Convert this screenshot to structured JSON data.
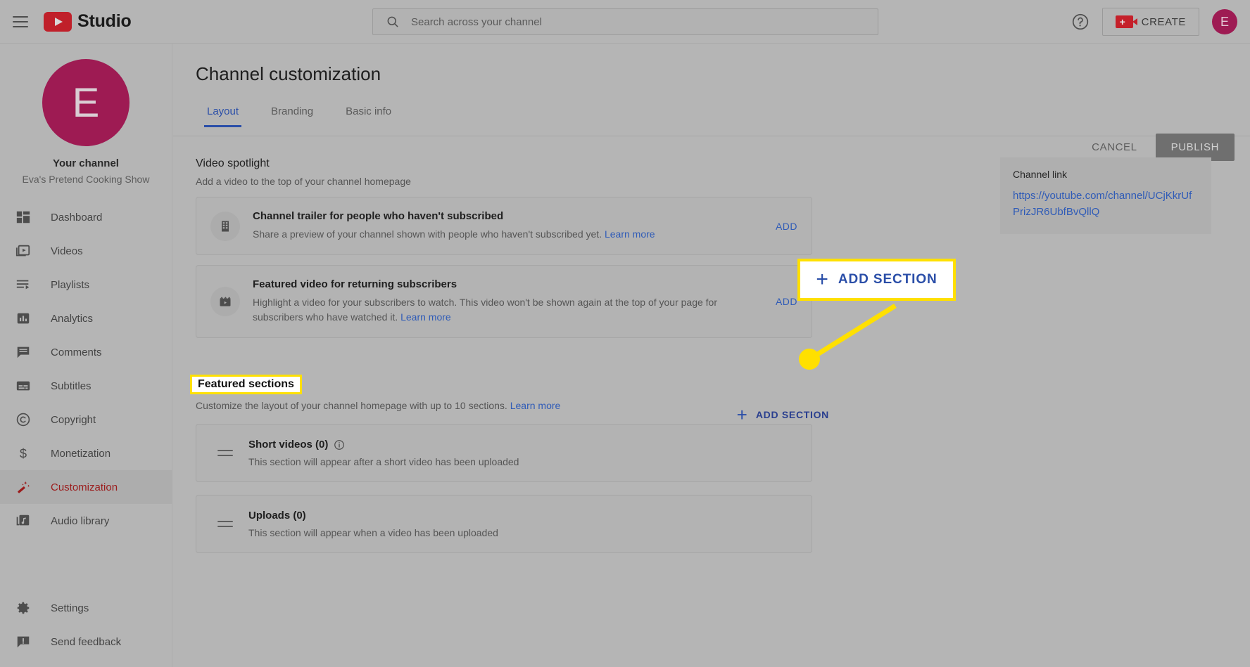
{
  "header": {
    "menu_icon": "hamburger-icon",
    "brand": "Studio",
    "logo_icon": "youtube-logo-icon",
    "search": {
      "placeholder": "Search across your channel",
      "value": "",
      "icon": "search-icon"
    },
    "help_icon": "help-circle-icon",
    "create_label": "CREATE",
    "create_icon": "video-camera-plus-icon",
    "avatar_initial": "E"
  },
  "sidebar": {
    "avatar_initial": "E",
    "channel_title": "Your channel",
    "channel_name": "Eva's Pretend Cooking Show",
    "items": [
      {
        "label": "Dashboard",
        "icon": "dashboard-grid-icon",
        "active": false
      },
      {
        "label": "Videos",
        "icon": "video-library-icon",
        "active": false
      },
      {
        "label": "Playlists",
        "icon": "playlist-icon",
        "active": false
      },
      {
        "label": "Analytics",
        "icon": "bar-chart-icon",
        "active": false
      },
      {
        "label": "Comments",
        "icon": "comment-bubble-icon",
        "active": false
      },
      {
        "label": "Subtitles",
        "icon": "subtitles-icon",
        "active": false
      },
      {
        "label": "Copyright",
        "icon": "copyright-icon",
        "active": false
      },
      {
        "label": "Monetization",
        "icon": "dollar-sign-icon",
        "active": false
      },
      {
        "label": "Customization",
        "icon": "magic-wand-icon",
        "active": true
      },
      {
        "label": "Audio library",
        "icon": "music-note-icon",
        "active": false
      }
    ],
    "bottom_items": [
      {
        "label": "Settings",
        "icon": "gear-icon"
      },
      {
        "label": "Send feedback",
        "icon": "feedback-icon"
      }
    ]
  },
  "main": {
    "page_title": "Channel customization",
    "tabs": [
      {
        "label": "Layout",
        "active": true
      },
      {
        "label": "Branding",
        "active": false
      },
      {
        "label": "Basic info",
        "active": false
      }
    ],
    "cancel_label": "CANCEL",
    "publish_label": "PUBLISH",
    "video_spotlight": {
      "heading": "Video spotlight",
      "subheading": "Add a video to the top of your channel homepage",
      "cards": [
        {
          "icon": "film-strip-icon",
          "title": "Channel trailer for people who haven't subscribed",
          "description": "Share a preview of your channel shown with people who haven't subscribed yet.",
          "learn_more": "Learn more",
          "add_label": "ADD"
        },
        {
          "icon": "clapperboard-icon",
          "title": "Featured video for returning subscribers",
          "description": "Highlight a video for your subscribers to watch. This video won't be shown again at the top of your page for subscribers who have watched it.",
          "learn_more": "Learn more",
          "add_label": "ADD"
        }
      ]
    },
    "featured_sections": {
      "heading": "Featured sections",
      "subheading": "Customize the layout of your channel homepage with up to 10 sections.",
      "learn_more": "Learn more",
      "add_section_label": "ADD SECTION",
      "add_section_icon": "plus-icon",
      "rows": [
        {
          "drag_icon": "drag-handle-icon",
          "title": "Short videos (0)",
          "info_icon": "info-circle-icon",
          "description": "This section will appear after a short video has been uploaded"
        },
        {
          "drag_icon": "drag-handle-icon",
          "title": "Uploads (0)",
          "info_icon": "",
          "description": "This section will appear when a video has been uploaded"
        }
      ]
    },
    "channel_link": {
      "label": "Channel link",
      "url": "https://youtube.com/channel/UCjKkrUfPrizJR6UbfBvQllQ"
    }
  },
  "callout": {
    "plus_icon": "plus-icon",
    "label": "ADD SECTION",
    "marker_icon": "highlight-dot-icon"
  },
  "colors": {
    "accent_blue": "#2a4ea8",
    "brand_red": "#c0202a",
    "highlight_yellow": "#ffe000",
    "avatar_magenta": "#9e1b53",
    "active_nav_red": "#9b1c1c"
  }
}
